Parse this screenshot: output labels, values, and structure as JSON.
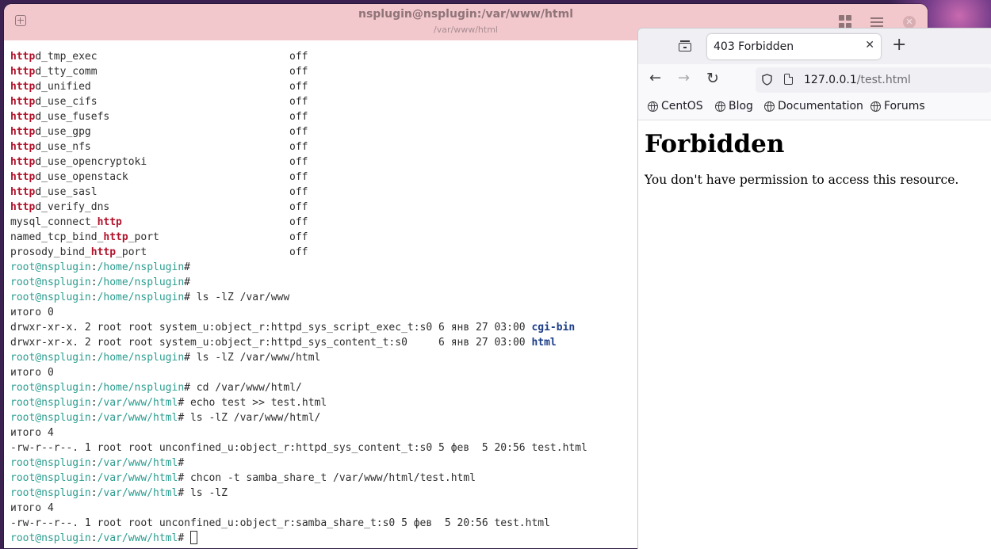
{
  "terminal": {
    "title": "nsplugin@nsplugin:/var/www/html",
    "subtitle": "/var/www/html",
    "prompt_user": "root@nsplugin",
    "settings": [
      {
        "pre": "",
        "hl": "http",
        "post": "d_tmp_exec",
        "value": "off"
      },
      {
        "pre": "",
        "hl": "http",
        "post": "d_tty_comm",
        "value": "off"
      },
      {
        "pre": "",
        "hl": "http",
        "post": "d_unified",
        "value": "off"
      },
      {
        "pre": "",
        "hl": "http",
        "post": "d_use_cifs",
        "value": "off"
      },
      {
        "pre": "",
        "hl": "http",
        "post": "d_use_fusefs",
        "value": "off"
      },
      {
        "pre": "",
        "hl": "http",
        "post": "d_use_gpg",
        "value": "off"
      },
      {
        "pre": "",
        "hl": "http",
        "post": "d_use_nfs",
        "value": "off"
      },
      {
        "pre": "",
        "hl": "http",
        "post": "d_use_opencryptoki",
        "value": "off"
      },
      {
        "pre": "",
        "hl": "http",
        "post": "d_use_openstack",
        "value": "off"
      },
      {
        "pre": "",
        "hl": "http",
        "post": "d_use_sasl",
        "value": "off"
      },
      {
        "pre": "",
        "hl": "http",
        "post": "d_verify_dns",
        "value": "off"
      },
      {
        "pre": "mysql_connect_",
        "hl": "http",
        "post": "",
        "value": "off"
      },
      {
        "pre": "named_tcp_bind_",
        "hl": "http",
        "post": "_port",
        "value": "off"
      },
      {
        "pre": "prosody_bind_",
        "hl": "http",
        "post": "_port",
        "value": "off"
      }
    ],
    "lines": [
      {
        "type": "prompt",
        "path": "/home/nsplugin",
        "cmd": ""
      },
      {
        "type": "prompt",
        "path": "/home/nsplugin",
        "cmd": ""
      },
      {
        "type": "prompt",
        "path": "/home/nsplugin",
        "cmd": " ls -lZ /var/www"
      },
      {
        "type": "text",
        "text": "итого 0"
      },
      {
        "type": "dir",
        "text": "drwxr-xr-x. 2 root root system_u:object_r:httpd_sys_script_exec_t:s0 6 янв 27 03:00 ",
        "name": "cgi-bin"
      },
      {
        "type": "dir",
        "text": "drwxr-xr-x. 2 root root system_u:object_r:httpd_sys_content_t:s0     6 янв 27 03:00 ",
        "name": "html"
      },
      {
        "type": "prompt",
        "path": "/home/nsplugin",
        "cmd": " ls -lZ /var/www/html"
      },
      {
        "type": "text",
        "text": "итого 0"
      },
      {
        "type": "prompt",
        "path": "/home/nsplugin",
        "cmd": " cd /var/www/html/"
      },
      {
        "type": "prompt",
        "path": "/var/www/html",
        "cmd": " echo test >> test.html"
      },
      {
        "type": "prompt",
        "path": "/var/www/html",
        "cmd": " ls -lZ /var/www/html/"
      },
      {
        "type": "text",
        "text": "итого 4"
      },
      {
        "type": "text",
        "text": "-rw-r--r--. 1 root root unconfined_u:object_r:httpd_sys_content_t:s0 5 фев  5 20:56 test.html"
      },
      {
        "type": "prompt",
        "path": "/var/www/html",
        "cmd": ""
      },
      {
        "type": "prompt",
        "path": "/var/www/html",
        "cmd": " chcon -t samba_share_t /var/www/html/test.html"
      },
      {
        "type": "prompt",
        "path": "/var/www/html",
        "cmd": " ls -lZ"
      },
      {
        "type": "text",
        "text": "итого 4"
      },
      {
        "type": "text",
        "text": "-rw-r--r--. 1 root root unconfined_u:object_r:samba_share_t:s0 5 фев  5 20:56 test.html"
      },
      {
        "type": "prompt",
        "path": "/var/www/html",
        "cmd": " ",
        "cursor": true
      }
    ]
  },
  "browser": {
    "tab_title": "403 Forbidden",
    "url_host": "127.0.0.1",
    "url_path": "/test.html",
    "bookmarks": [
      "CentOS",
      "Blog",
      "Documentation",
      "Forums"
    ],
    "heading": "Forbidden",
    "message": "You don't have permission to access this resource."
  }
}
